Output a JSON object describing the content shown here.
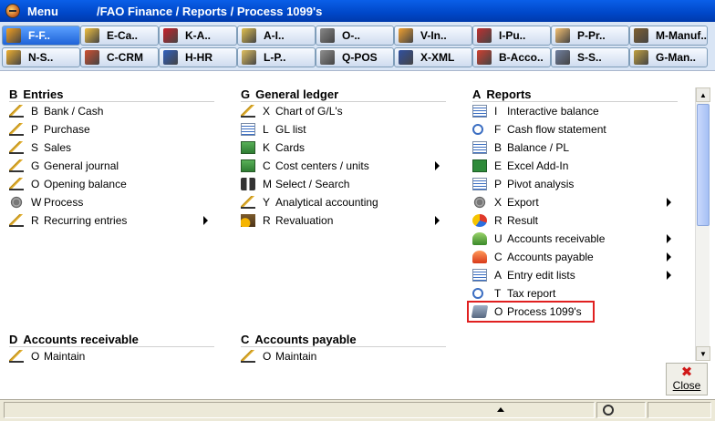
{
  "window": {
    "menu_label": "Menu",
    "title_path": "/FAO  Finance / Reports / Process 1099's"
  },
  "toolbar": {
    "row1": [
      {
        "label": "F-F..",
        "icon": "finance-icon",
        "color": "#f4a020",
        "active": true
      },
      {
        "label": "E-Ca..",
        "icon": "cash-icon",
        "color": "#f0c040"
      },
      {
        "label": "K-A..",
        "icon": "accounts-icon",
        "color": "#c8202a"
      },
      {
        "label": "A-I..",
        "icon": "inventory-icon",
        "color": "#e0c050"
      },
      {
        "label": "O-..",
        "icon": "order-icon",
        "color": "#888888"
      },
      {
        "label": "V-In..",
        "icon": "invoice-icon",
        "color": "#f0a030"
      },
      {
        "label": "I-Pu..",
        "icon": "purchase-icon",
        "color": "#c03030"
      },
      {
        "label": "P-Pr..",
        "icon": "production-icon",
        "color": "#f4c070"
      },
      {
        "label": "M-Manuf..",
        "icon": "manufacturing-icon",
        "color": "#806030"
      }
    ],
    "row2": [
      {
        "label": "N-S..",
        "icon": "sales-icon",
        "color": "#f0b030"
      },
      {
        "label": "C-CRM",
        "icon": "crm-icon",
        "color": "#d05030"
      },
      {
        "label": "H-HR",
        "icon": "hr-icon",
        "color": "#3060c0"
      },
      {
        "label": "L-P..",
        "icon": "payroll-icon",
        "color": "#e0c060"
      },
      {
        "label": "Q-POS",
        "icon": "pos-icon",
        "color": "#909090"
      },
      {
        "label": "X-XML",
        "icon": "xml-icon",
        "color": "#3050a0"
      },
      {
        "label": "B-Acco..",
        "icon": "accounting-icon",
        "color": "#d04030"
      },
      {
        "label": "S-S..",
        "icon": "system-icon",
        "color": "#7080a0"
      },
      {
        "label": "G-Man..",
        "icon": "management-icon",
        "color": "#c0a040"
      }
    ]
  },
  "sections": {
    "entries": {
      "key": "B",
      "title": "Entries",
      "items": [
        {
          "key": "B",
          "label": "Bank / Cash",
          "icon": "pen"
        },
        {
          "key": "P",
          "label": "Purchase",
          "icon": "pen"
        },
        {
          "key": "S",
          "label": "Sales",
          "icon": "pen"
        },
        {
          "key": "G",
          "label": "General journal",
          "icon": "pen"
        },
        {
          "key": "O",
          "label": "Opening balance",
          "icon": "pen"
        },
        {
          "key": "W",
          "label": "Process",
          "icon": "gear"
        },
        {
          "key": "R",
          "label": "Recurring entries",
          "icon": "pen",
          "submenu": true
        }
      ]
    },
    "general_ledger": {
      "key": "G",
      "title": "General ledger",
      "items": [
        {
          "key": "X",
          "label": "Chart of G/L's",
          "icon": "pen"
        },
        {
          "key": "L",
          "label": "GL list",
          "icon": "list"
        },
        {
          "key": "K",
          "label": "Cards",
          "icon": "cards"
        },
        {
          "key": "C",
          "label": "Cost centers / units",
          "icon": "cards",
          "submenu": true
        },
        {
          "key": "M",
          "label": "Select / Search",
          "icon": "select"
        },
        {
          "key": "Y",
          "label": "Analytical accounting",
          "icon": "pen"
        },
        {
          "key": "R",
          "label": "Revaluation",
          "icon": "coins",
          "submenu": true
        }
      ]
    },
    "reports": {
      "key": "A",
      "title": "Reports",
      "items": [
        {
          "key": "I",
          "label": "Interactive balance",
          "icon": "list"
        },
        {
          "key": "F",
          "label": "Cash flow statement",
          "icon": "mag"
        },
        {
          "key": "B",
          "label": "Balance / PL",
          "icon": "list"
        },
        {
          "key": "E",
          "label": "Excel Add-In",
          "icon": "excel"
        },
        {
          "key": "P",
          "label": "Pivot analysis",
          "icon": "list"
        },
        {
          "key": "X",
          "label": "Export",
          "icon": "gear",
          "submenu": true
        },
        {
          "key": "R",
          "label": "Result",
          "icon": "pie"
        },
        {
          "key": "U",
          "label": "Accounts receivable",
          "icon": "recv",
          "submenu": true
        },
        {
          "key": "C",
          "label": "Accounts payable",
          "icon": "pay",
          "submenu": true
        },
        {
          "key": "A",
          "label": "Entry edit lists",
          "icon": "list",
          "submenu": true
        },
        {
          "key": "T",
          "label": "Tax report",
          "icon": "mag"
        },
        {
          "key": "O",
          "label": "Process 1099's",
          "icon": "proc",
          "highlight": true
        }
      ]
    },
    "accounts_receivable": {
      "key": "D",
      "title": "Accounts receivable",
      "items": [
        {
          "key": "O",
          "label": "Maintain",
          "icon": "pen"
        }
      ]
    },
    "accounts_payable": {
      "key": "C",
      "title": "Accounts payable",
      "items": [
        {
          "key": "O",
          "label": "Maintain",
          "icon": "pen"
        }
      ]
    }
  },
  "close_button": {
    "label": "Close",
    "icon": "close-icon",
    "color": "#d01818"
  },
  "colors": {
    "titlebar": "#0047c8",
    "highlight_border": "#e02020",
    "toolbar_active": "#1f63d8"
  }
}
